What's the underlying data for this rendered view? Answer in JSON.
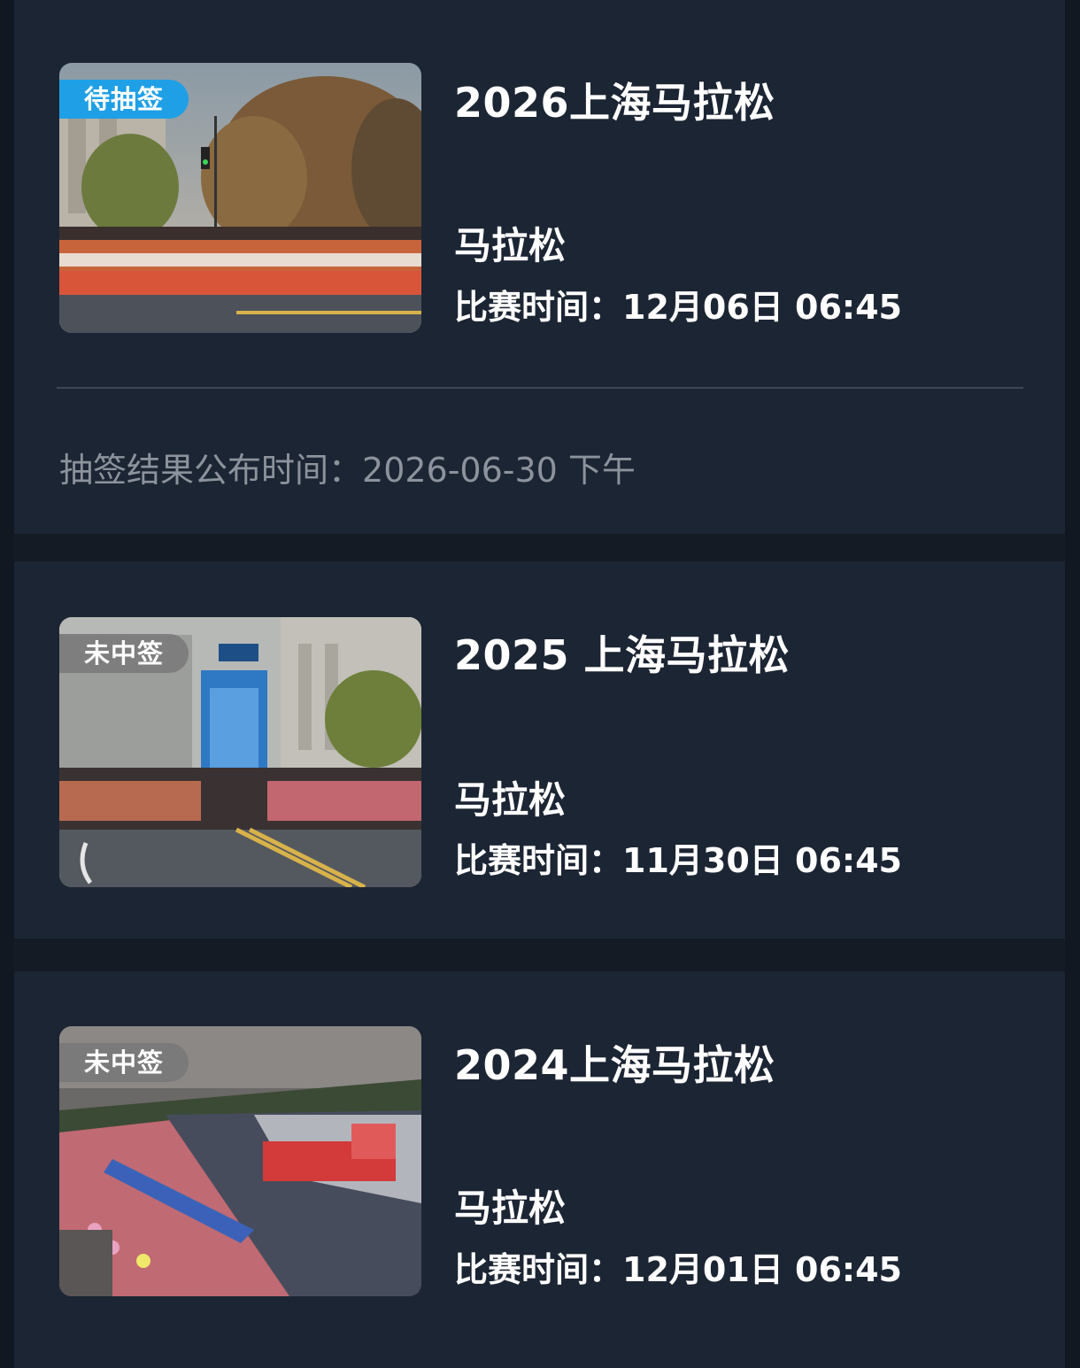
{
  "events": [
    {
      "status": "待抽签",
      "title": "2026上海马拉松",
      "category": "马拉松",
      "time_label": "比赛时间：",
      "time_value": "12月06日 06:45",
      "lottery_label": "抽签结果公布时间：",
      "lottery_value": "2026-06-30 下午",
      "image": "marathon-start-photo"
    },
    {
      "status": "未中签",
      "title": "2025 上海马拉松",
      "category": "马拉松",
      "time_label": "比赛时间：",
      "time_value": "11月30日 06:45",
      "image": "marathon-start-arch-photo"
    },
    {
      "status": "未中签",
      "title": "2024上海马拉松",
      "category": "马拉松",
      "time_label": "比赛时间：",
      "time_value": "12月01日 06:45",
      "image": "marathon-aerial-photo"
    }
  ],
  "colors": {
    "background": "#141b24",
    "card": "#1c2533",
    "pending_badge": "#1fa0e6",
    "lost_badge": "#787878",
    "muted_text": "#8c939d"
  }
}
